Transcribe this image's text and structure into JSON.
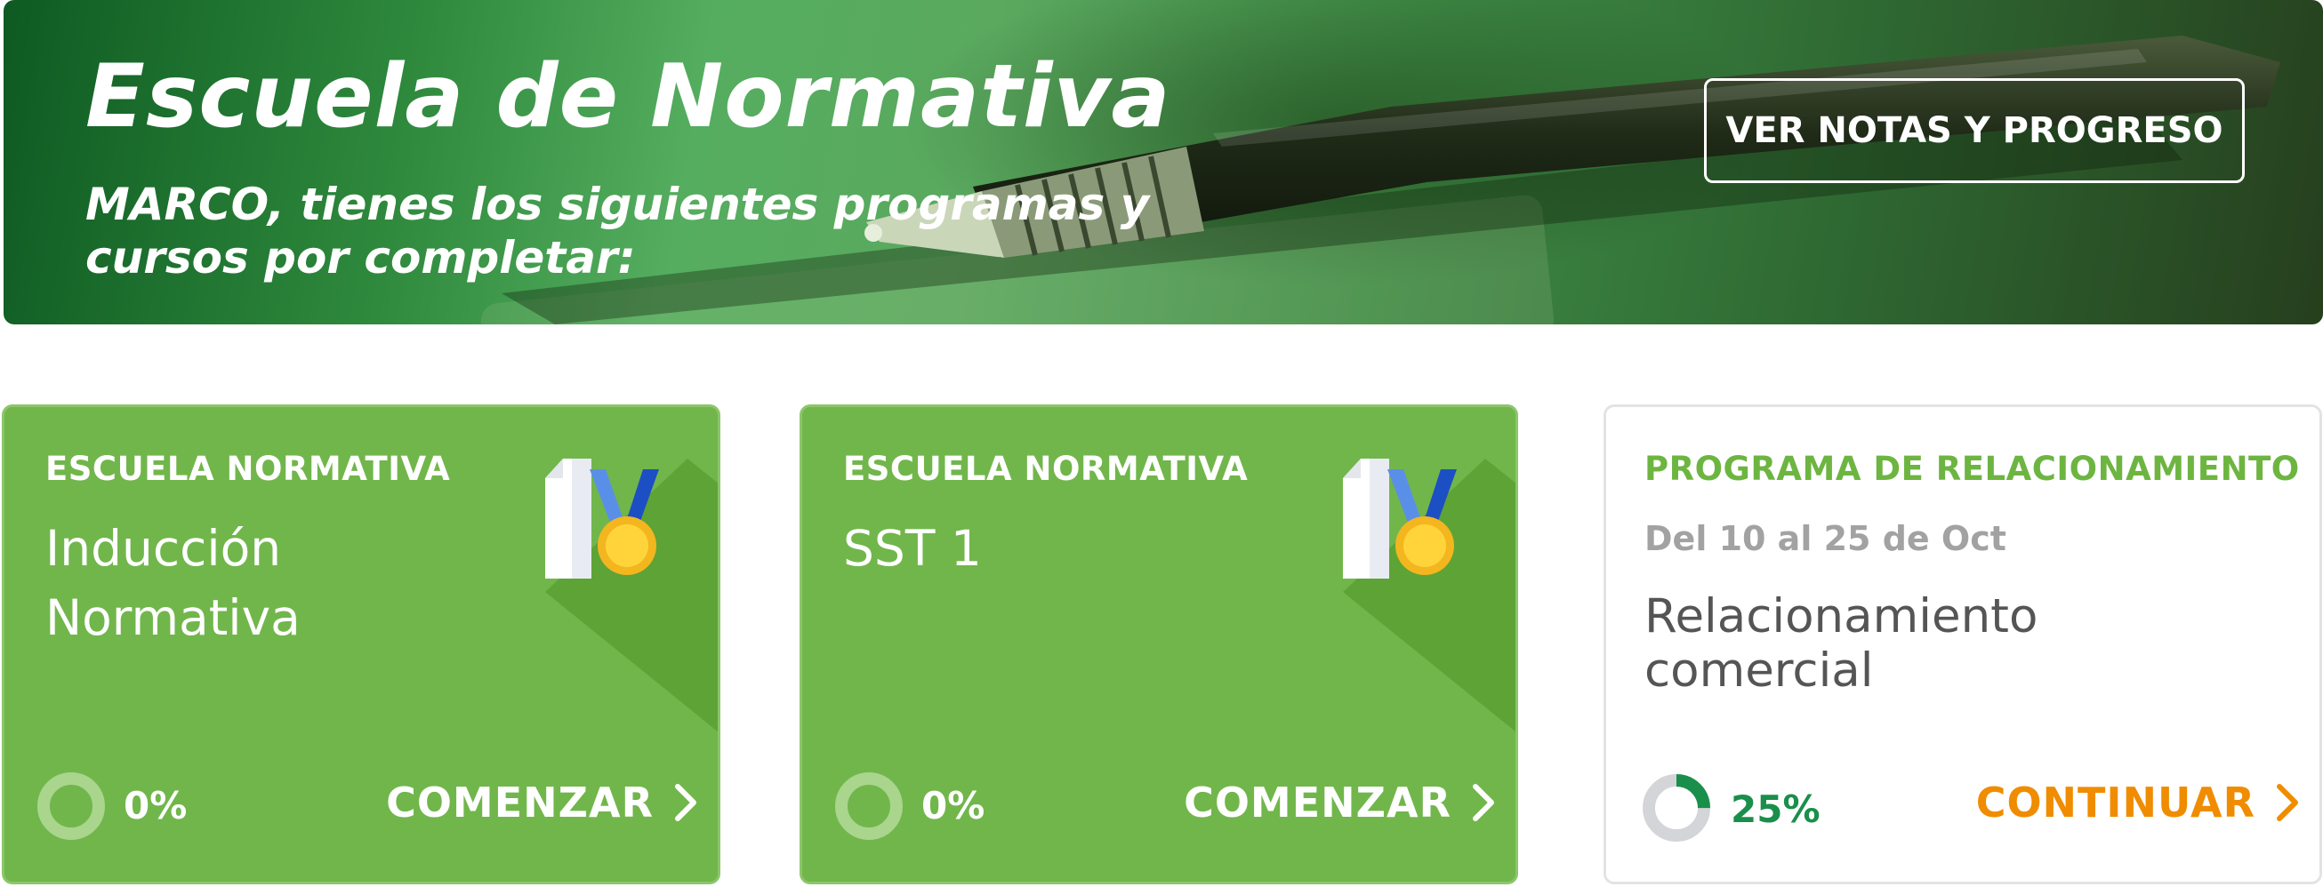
{
  "banner": {
    "title": "Escuela de Normativa",
    "subtitle_line1": "MARCO, tienes los siguientes programas y",
    "subtitle_line2": "cursos por completar:",
    "progress_button_label": "VER NOTAS Y PROGRESO"
  },
  "cards": [
    {
      "eyebrow": "ESCUELA NORMATIVA",
      "title": "Inducción Normativa",
      "icon": "medal-certificate-icon",
      "progress": 0,
      "progress_label": "0%",
      "action_label": "COMENZAR"
    },
    {
      "eyebrow": "ESCUELA NORMATIVA",
      "title": "SST 1",
      "icon": "medal-certificate-icon",
      "progress": 0,
      "progress_label": "0%",
      "action_label": "COMENZAR"
    },
    {
      "eyebrow": "PROGRAMA DE RELACIONAMIENTO",
      "date": "Del 10 al 25 de Oct",
      "title": "Relacionamiento comercial",
      "progress": 0.25,
      "progress_label": "25%",
      "action_label": "CONTINUAR"
    }
  ],
  "colors": {
    "card_green": "#71b64b",
    "accent_green": "#6db541",
    "progress_green": "#1a8f4b",
    "action_orange": "#f08c00",
    "medal_blue": "#2563c9",
    "medal_gold": "#f5c518"
  }
}
